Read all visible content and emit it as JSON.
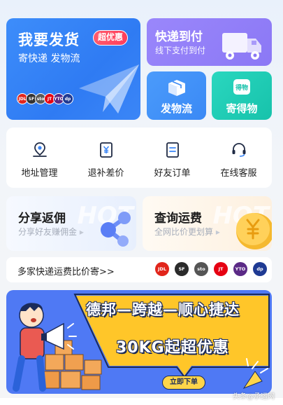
{
  "send": {
    "title": "我要发货",
    "badge": "超优惠",
    "subtitle": "寄快递 发物流",
    "carriers": [
      {
        "name": "JDL",
        "color": "#e1251b"
      },
      {
        "name": "SF",
        "color": "#333333"
      },
      {
        "name": "sto",
        "color": "#5a5a5a"
      },
      {
        "name": "JT",
        "color": "#e60012"
      },
      {
        "name": "YTO",
        "color": "#5b2a86"
      },
      {
        "name": "dp",
        "color": "#1f3a93"
      }
    ]
  },
  "cod": {
    "title": "快递到付",
    "subtitle": "线下支付到付"
  },
  "ship_freight": {
    "label": "发物流",
    "icon": "box-icon"
  },
  "send_receive": {
    "label": "寄得物",
    "icon": "dewu-icon",
    "icon_text": "得物"
  },
  "services": [
    {
      "label": "地址管理",
      "icon": "location-pin-icon"
    },
    {
      "label": "退补差价",
      "icon": "yen-receipt-icon"
    },
    {
      "label": "好友订单",
      "icon": "order-list-icon"
    },
    {
      "label": "在线客服",
      "icon": "headset-icon"
    }
  ],
  "share": {
    "title": "分享返佣",
    "subtitle": "分享好友赚佣金",
    "bg_word": "HOT"
  },
  "query": {
    "title": "查询运费",
    "subtitle": "全网比价更划算",
    "bg_word": "HOT"
  },
  "compare": {
    "label": "多家快递运费比价寄>>",
    "carriers": [
      {
        "name": "JDL",
        "color": "#e1251b"
      },
      {
        "name": "SF",
        "color": "#2b2b2b"
      },
      {
        "name": "sto",
        "color": "#555555"
      },
      {
        "name": "JT",
        "color": "#e60012"
      },
      {
        "name": "YTO",
        "color": "#5b2a86"
      },
      {
        "name": "dp",
        "color": "#1f3a93"
      }
    ]
  },
  "banner": {
    "line1": "德邦—跨越—顺心捷达",
    "line2": "30KG起超优惠",
    "cta": "立即下单"
  },
  "watermark": "头条@承运网"
}
